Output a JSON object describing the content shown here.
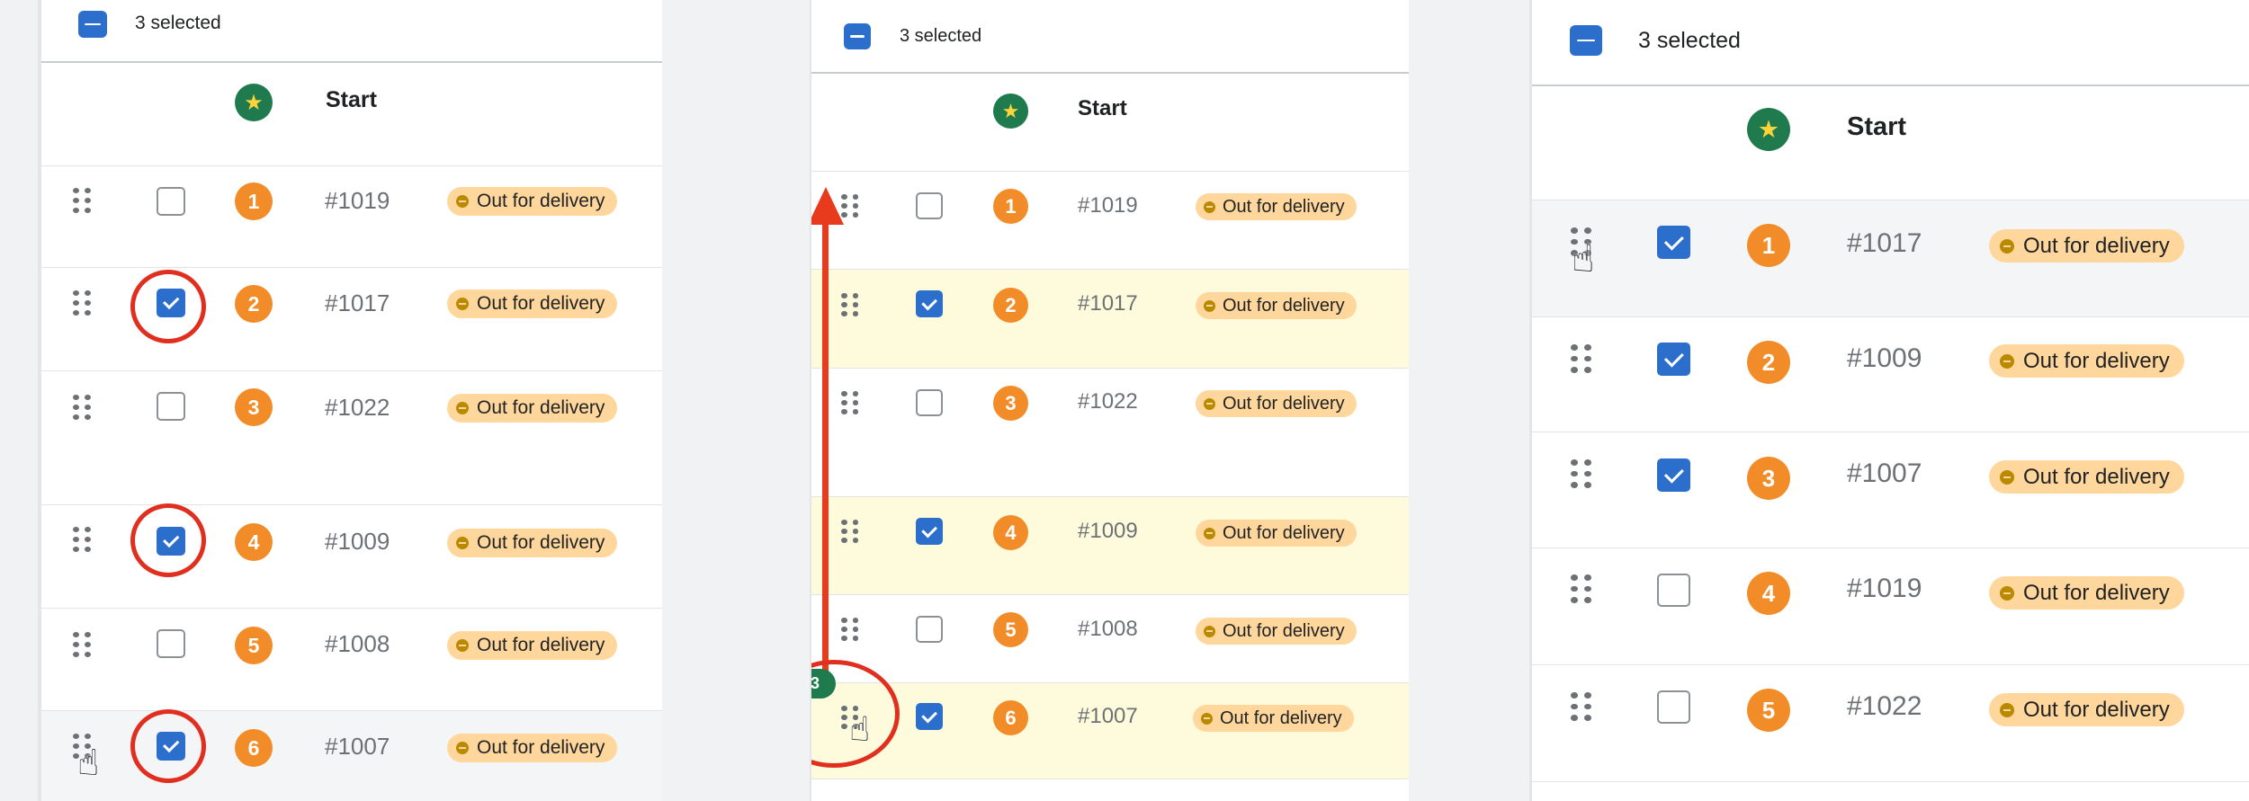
{
  "header": {
    "selected_text": "3 selected"
  },
  "columns": {
    "start_label": "Start"
  },
  "status_label": "Out for delivery",
  "colors": {
    "accent": "#2c6ecb",
    "badge_orange": "#f28c28",
    "status_pill": "#ffd79d",
    "highlight_row": "#fefbdc",
    "annotation_red": "#e02f1f",
    "star_badge": "#1f7a4d"
  },
  "panels": [
    {
      "rows": [
        {
          "pos": "1",
          "order": "#1019",
          "checked": false
        },
        {
          "pos": "2",
          "order": "#1017",
          "checked": true
        },
        {
          "pos": "3",
          "order": "#1022",
          "checked": false
        },
        {
          "pos": "4",
          "order": "#1009",
          "checked": true
        },
        {
          "pos": "5",
          "order": "#1008",
          "checked": false
        },
        {
          "pos": "6",
          "order": "#1007",
          "checked": true
        }
      ]
    },
    {
      "drag_count": "3",
      "rows": [
        {
          "pos": "1",
          "order": "#1019",
          "checked": false
        },
        {
          "pos": "2",
          "order": "#1017",
          "checked": true
        },
        {
          "pos": "3",
          "order": "#1022",
          "checked": false
        },
        {
          "pos": "4",
          "order": "#1009",
          "checked": true
        },
        {
          "pos": "5",
          "order": "#1008",
          "checked": false
        },
        {
          "pos": "6",
          "order": "#1007",
          "checked": true
        }
      ]
    },
    {
      "rows": [
        {
          "pos": "1",
          "order": "#1017",
          "checked": true
        },
        {
          "pos": "2",
          "order": "#1009",
          "checked": true
        },
        {
          "pos": "3",
          "order": "#1007",
          "checked": true
        },
        {
          "pos": "4",
          "order": "#1019",
          "checked": false
        },
        {
          "pos": "5",
          "order": "#1022",
          "checked": false
        }
      ]
    }
  ]
}
